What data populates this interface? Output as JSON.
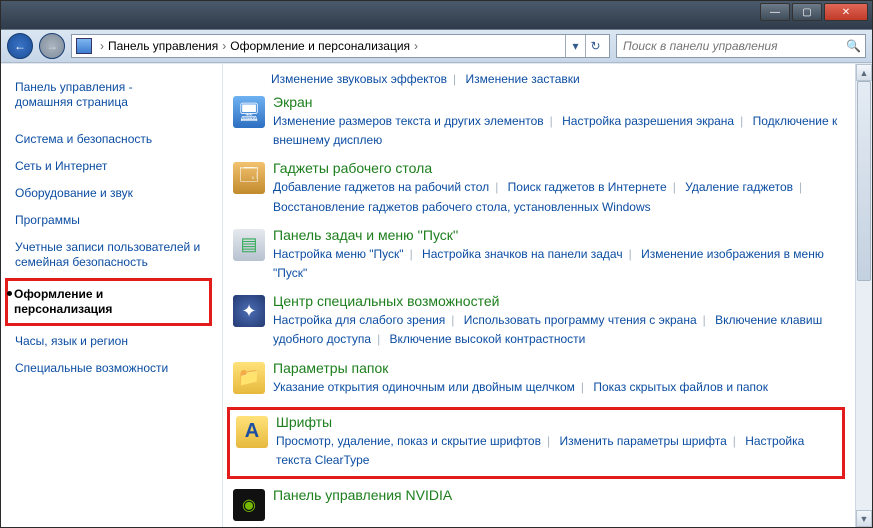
{
  "titlebar": {
    "min": "—",
    "max": "▢",
    "close": "✕"
  },
  "breadcrumb": {
    "seg1": "Панель управления",
    "seg2": "Оформление и персонализация",
    "arrow": "›"
  },
  "search": {
    "placeholder": "Поиск в панели управления"
  },
  "sidebar": {
    "home_l1": "Панель управления -",
    "home_l2": "домашняя страница",
    "items": [
      "Система и безопасность",
      "Сеть и Интернет",
      "Оборудование и звук",
      "Программы",
      "Учетные записи пользователей и семейная безопасность",
      "Оформление и персонализация",
      "Часы, язык и регион",
      "Специальные возможности"
    ]
  },
  "toplinks": {
    "a": "Изменение звуковых эффектов",
    "b": "Изменение заставки"
  },
  "cats": [
    {
      "title": "Экран",
      "links": [
        "Изменение размеров текста и других элементов",
        "Настройка разрешения экрана",
        "Подключение к внешнему дисплею"
      ]
    },
    {
      "title": "Гаджеты рабочего стола",
      "links": [
        "Добавление гаджетов на рабочий стол",
        "Поиск гаджетов в Интернете",
        "Удаление гаджетов",
        "Восстановление гаджетов рабочего стола, установленных Windows"
      ]
    },
    {
      "title": "Панель задач и меню ''Пуск''",
      "links": [
        "Настройка меню \"Пуск\"",
        "Настройка значков на панели задач",
        "Изменение изображения в меню \"Пуск\""
      ]
    },
    {
      "title": "Центр специальных возможностей",
      "links": [
        "Настройка для слабого зрения",
        "Использовать программу чтения с экрана",
        "Включение клавиш удобного доступа",
        "Включение высокой контрастности"
      ]
    },
    {
      "title": "Параметры папок",
      "links": [
        "Указание открытия одиночным или двойным щелчком",
        "Показ скрытых файлов и папок"
      ]
    },
    {
      "title": "Шрифты",
      "links": [
        "Просмотр, удаление, показ и скрытие шрифтов",
        "Изменить параметры шрифта",
        "Настройка текста ClearType"
      ]
    },
    {
      "title": "Панель управления NVIDIA",
      "links": []
    }
  ]
}
